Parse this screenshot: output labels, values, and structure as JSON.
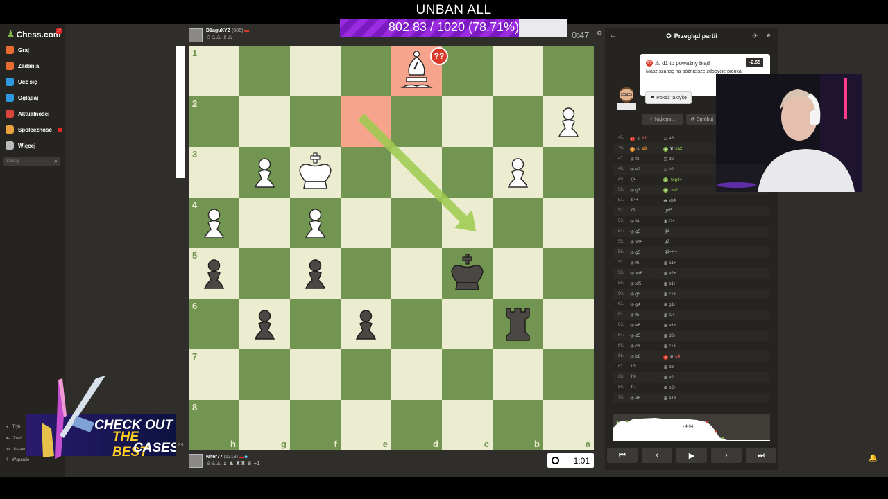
{
  "overlay": {
    "title": "UNBAN ALL",
    "progress_text": "802.83 / 1020 (78.71%)",
    "progress_fraction": 0.7871
  },
  "sidebar": {
    "logo": "Chess.com",
    "logo_badge": "17",
    "items": [
      {
        "label": "Graj",
        "icon": "pawn-icon",
        "color": "#e96c2e"
      },
      {
        "label": "Zadania",
        "icon": "puzzle-icon",
        "color": "#e96c2e"
      },
      {
        "label": "Ucz się",
        "icon": "lessons-icon",
        "color": "#2d9ae0"
      },
      {
        "label": "Oglądaj",
        "icon": "watch-icon",
        "color": "#2d9ae0"
      },
      {
        "label": "Aktualności",
        "icon": "news-icon",
        "color": "#d9443c"
      },
      {
        "label": "Społeczność",
        "icon": "community-icon",
        "color": "#e9a23b",
        "badge": "1"
      },
      {
        "label": "Więcej",
        "icon": "more-icon",
        "color": "#bababa"
      }
    ],
    "search_placeholder": "Szukaj",
    "footer": [
      "Tryb",
      "Zwiń",
      "Ustaw",
      "Wsparcie"
    ]
  },
  "top_player": {
    "name": "D1aguXYZ",
    "rating": "(886)",
    "captured": "♙♙♙ ♗♙",
    "clock": "0:47"
  },
  "bottom_player": {
    "name": "Niter77",
    "rating": "(1318)",
    "captured": "♙♙♙ ♝ ♞ ♜♜ ♛ +1",
    "clock": "1:01"
  },
  "board": {
    "orientation": "black",
    "ranks": [
      "1",
      "2",
      "3",
      "4",
      "5",
      "6",
      "7",
      "8"
    ],
    "files": [
      "h",
      "g",
      "f",
      "e",
      "d",
      "c",
      "b",
      "a"
    ],
    "highlight_from": "e2",
    "highlight_to": "d1",
    "arrow": {
      "from": "e2",
      "to": "c4",
      "color": "#9ccb4e"
    },
    "blunder_badge": "??",
    "pieces": [
      {
        "sq": "d1",
        "piece": "wB"
      },
      {
        "sq": "a2",
        "piece": "wP"
      },
      {
        "sq": "g3",
        "piece": "wP"
      },
      {
        "sq": "f3",
        "piece": "wK"
      },
      {
        "sq": "b3",
        "piece": "wP"
      },
      {
        "sq": "h4",
        "piece": "wP"
      },
      {
        "sq": "f4",
        "piece": "wP"
      },
      {
        "sq": "h5",
        "piece": "bP"
      },
      {
        "sq": "f5",
        "piece": "bP"
      },
      {
        "sq": "c5",
        "piece": "bK"
      },
      {
        "sq": "g6",
        "piece": "bP"
      },
      {
        "sq": "e6",
        "piece": "bP"
      },
      {
        "sq": "b6",
        "piece": "bR"
      }
    ]
  },
  "panel": {
    "title": "Przegląd partii",
    "coach": {
      "title": "d1 to poważny błąd",
      "eval": "-2.55",
      "text": "Masz szansę na późniejsze zdobycie pionka.",
      "tactic_button": "Pokaż taktykę"
    },
    "best_button": "Najleps...",
    "retry_button": "Spróbuj",
    "moves": [
      {
        "n": "45.",
        "w": "d1",
        "wp": "♗",
        "wt": "blunder",
        "b": "a6",
        "bp": "♖"
      },
      {
        "n": "46.",
        "w": "e3",
        "wp": "♔",
        "wt": "mistake",
        "b": "xa2",
        "bp": "♜",
        "bt": "best"
      },
      {
        "n": "47.",
        "w": "f3",
        "wp": "♔",
        "b": "d2",
        "bp": "♖"
      },
      {
        "n": "48.",
        "w": "e2",
        "wp": "♔",
        "b": "b2",
        "bp": "♖"
      },
      {
        "n": "49.",
        "w": "g4",
        "wp": "",
        "b": "fxg4+",
        "bt": "best"
      },
      {
        "n": "50.",
        "w": "g3",
        "wp": "♔",
        "b": "xe2",
        "bt": "best"
      },
      {
        "n": "51.",
        "w": "b4+",
        "wp": "",
        "b": "xb4",
        "bp": "♚"
      },
      {
        "n": "52.",
        "w": "f5",
        "wp": "",
        "b": "gxf5"
      },
      {
        "n": "53.",
        "w": "f4",
        "wp": "♔",
        "b": "f2+",
        "bp": "♜"
      },
      {
        "n": "54.",
        "w": "g5",
        "wp": "♔",
        "b": "g3"
      },
      {
        "n": "55.",
        "w": "xh5",
        "wp": "♔",
        "b": "g2"
      },
      {
        "n": "56.",
        "w": "g5",
        "wp": "♔",
        "b": "g1=H+"
      },
      {
        "n": "57.",
        "w": "f6",
        "wp": "♔",
        "b": "a1+",
        "bp": "♛"
      },
      {
        "n": "58.",
        "w": "xe6",
        "wp": "♔",
        "b": "e2+",
        "bp": "♛"
      },
      {
        "n": "59.",
        "w": "xf5",
        "wp": "♔",
        "b": "b1+",
        "bp": "♛"
      },
      {
        "n": "60.",
        "w": "g5",
        "wp": "♔",
        "b": "c1+",
        "bp": "♛"
      },
      {
        "n": "61.",
        "w": "g4",
        "wp": "♔",
        "b": "g1+",
        "bp": "♛"
      },
      {
        "n": "62.",
        "w": "f5",
        "wp": "♔",
        "b": "f2+",
        "bp": "♛"
      },
      {
        "n": "63.",
        "w": "e6",
        "wp": "♔",
        "b": "e1+",
        "bp": "♛"
      },
      {
        "n": "64.",
        "w": "d5",
        "wp": "♔",
        "b": "d2+",
        "bp": "♛"
      },
      {
        "n": "65.",
        "w": "c6",
        "wp": "♔",
        "b": "c1+",
        "bp": "♛"
      },
      {
        "n": "66.",
        "w": "b6",
        "wp": "♔",
        "b": "c4",
        "bp": "♛",
        "bt": "miss"
      },
      {
        "n": "67.",
        "w": "h5",
        "wp": "",
        "b": "d3",
        "bp": "♛"
      },
      {
        "n": "68.",
        "w": "h6",
        "wp": "",
        "b": "e2",
        "bp": "♛"
      },
      {
        "n": "69.",
        "w": "h7",
        "wp": "",
        "b": "b2+",
        "bp": "♛"
      },
      {
        "n": "70.",
        "w": "a6",
        "wp": "♔",
        "b": "a1#",
        "bp": "♛"
      }
    ],
    "graph_tip": "+4.04"
  },
  "ad": {
    "line1": "CHECK OUT",
    "line2": "THE BEST",
    "line3": "CASES",
    "badge": "2.5"
  },
  "colors": {
    "board_light": "#ebecd0",
    "board_dark": "#739552",
    "accent_green": "#81b64c",
    "blunder_red": "#d93a2b"
  }
}
